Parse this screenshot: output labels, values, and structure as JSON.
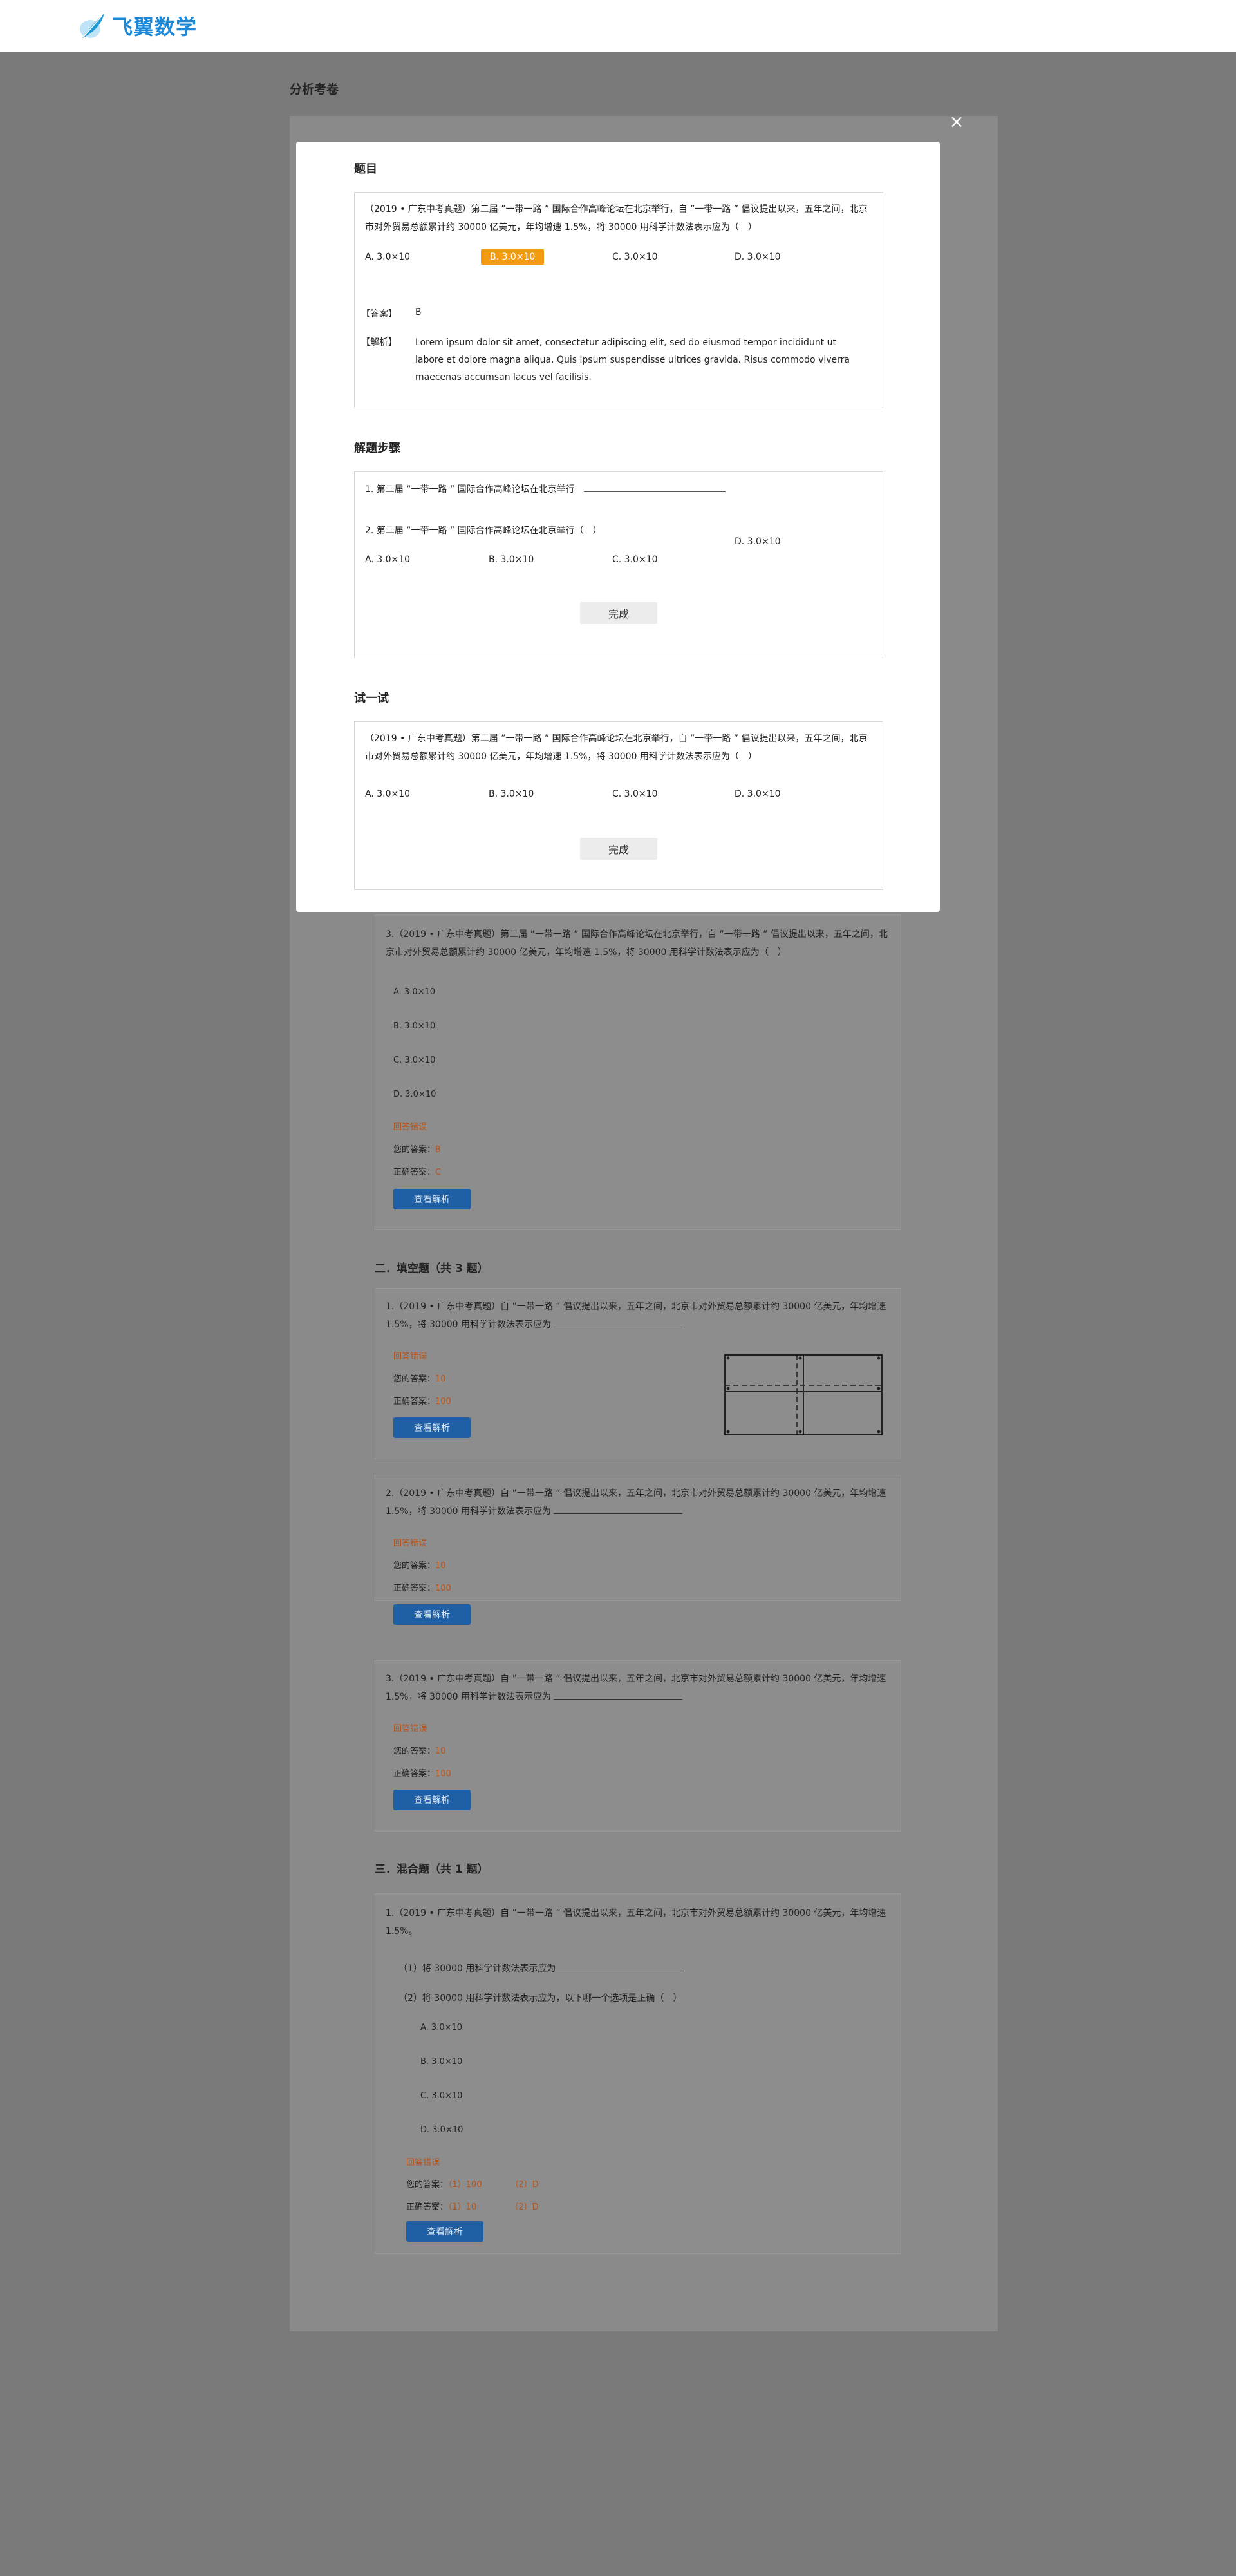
{
  "brand": {
    "name": "飞翼数学"
  },
  "page": {
    "title": "分析考卷"
  },
  "modal": {
    "close_glyph": "×",
    "section1": {
      "title": "题目",
      "question": "（2019 • 广东中考真题）第二届 ”一带一路 ” 国际合作高峰论坛在北京举行，自 ”一带一路 ” 倡议提出以来，五年之间，北京市对外贸易总额累计约 30000 亿美元，年均增速 1.5%，将 30000 用科学计数法表示应为（　）",
      "options": [
        "A.  3.0×10",
        "B.  3.0×10",
        "C.  3.0×10",
        "D.  3.0×10"
      ],
      "answer_label": "【答案】",
      "answer_value": "B",
      "analysis_label": "【解析】",
      "analysis_text": "Lorem ipsum dolor sit amet, consectetur adipiscing elit, sed do eiusmod tempor incididunt ut labore et dolore magna aliqua. Quis ipsum suspendisse ultrices gravida. Risus commodo viverra maecenas accumsan lacus vel facilisis."
    },
    "section2": {
      "title": "解题步骤",
      "step1": "1. 第二届 ”一带一路 ” 国际合作高峰论坛在北京举行",
      "step2": "2. 第二届 ”一带一路 ” 国际合作高峰论坛在北京举行（　）",
      "options": [
        "A.  3.0×10",
        "B.  3.0×10",
        "C.  3.0×10",
        "D.  3.0×10"
      ],
      "done_label": "完成"
    },
    "section3": {
      "title": "试一试",
      "question": "（2019 • 广东中考真题）第二届 ”一带一路 ” 国际合作高峰论坛在北京举行，自 ”一带一路 ” 倡议提出以来，五年之间，北京市对外贸易总额累计约 30000 亿美元，年均增速 1.5%，将 30000 用科学计数法表示应为（　）",
      "options": [
        "A.  3.0×10",
        "B.  3.0×10",
        "C.  3.0×10",
        "D.  3.0×10"
      ],
      "done_label": "完成"
    }
  },
  "choice_q3": {
    "question": "3.（2019 • 广东中考真题）第二届 ”一带一路 ” 国际合作高峰论坛在北京举行，自 ”一带一路 ” 倡议提出以来，五年之间，北京市对外贸易总额累计约 30000 亿美元，年均增速 1.5%，将 30000 用科学计数法表示应为（　）",
    "options": [
      "A.  3.0×10",
      "B.  3.0×10",
      "C.  3.0×10",
      "D.  3.0×10"
    ],
    "status": "回答错误",
    "your_label": "您的答案：",
    "your_value": "B",
    "correct_label": "正确答案：",
    "correct_value": "C",
    "btn": "查看解析"
  },
  "fill": {
    "title": "二．填空题（共 3 题）",
    "items": [
      {
        "question": "1.（2019 • 广东中考真题）自 ”一带一路 ” 倡议提出以来，五年之间，北京市对外贸易总额累计约 30000 亿美元，年均增速 1.5%，将 30000 用科学计数法表示应为",
        "status": "回答错误",
        "your_label": "您的答案：",
        "your_value": "10",
        "correct_label": "正确答案：",
        "correct_value": "100",
        "btn": "查看解析"
      },
      {
        "question": "2.（2019 • 广东中考真题）自 ”一带一路 ” 倡议提出以来，五年之间，北京市对外贸易总额累计约 30000 亿美元，年均增速 1.5%，将 30000 用科学计数法表示应为",
        "status": "回答错误",
        "your_label": "您的答案：",
        "your_value": "10",
        "correct_label": "正确答案：",
        "correct_value": "100",
        "btn": "查看解析"
      },
      {
        "question": "3.（2019 • 广东中考真题）自 ”一带一路 ” 倡议提出以来，五年之间，北京市对外贸易总额累计约 30000 亿美元，年均增速 1.5%，将 30000 用科学计数法表示应为",
        "status": "回答错误",
        "your_label": "您的答案：",
        "your_value": "10",
        "correct_label": "正确答案：",
        "correct_value": "100",
        "btn": "查看解析"
      }
    ]
  },
  "mixed": {
    "title": "三．混合题（共 1 题）",
    "question": "1.（2019 • 广东中考真题）自 ”一带一路 ” 倡议提出以来，五年之间，北京市对外贸易总额累计约 30000 亿美元，年均增速 1.5%。",
    "sub1": "（1）将 30000 用科学计数法表示应为",
    "sub2": "（2）将 30000 用科学计数法表示应为，以下哪一个选项是正确（　）",
    "options": [
      "A.  3.0×10",
      "B.  3.0×10",
      "C.  3.0×10",
      "D.  3.0×10"
    ],
    "status": "回答错误",
    "your_label": "您的答案：",
    "your_values": [
      "（1）100",
      "（2）D"
    ],
    "correct_label": "正确答案：",
    "correct_values": [
      "（1）10",
      "（2）D"
    ],
    "btn": "查看解析"
  }
}
